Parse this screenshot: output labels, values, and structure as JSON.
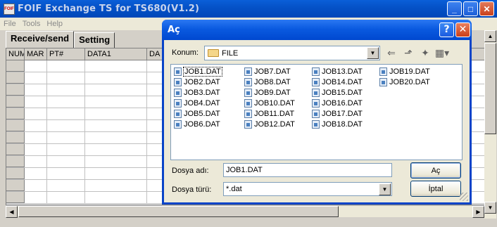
{
  "main_window": {
    "title": "FOIF Exchange TS for TS680(V1.2)",
    "icon_text": "FOIF",
    "minimize": "_",
    "maximize": "□",
    "close": "✕"
  },
  "menu": [
    "File",
    "Tools",
    "Help"
  ],
  "tabs": [
    {
      "label": "Receive/send",
      "active": true
    },
    {
      "label": "Setting",
      "active": false
    }
  ],
  "grid": {
    "columns": [
      "NUM",
      "MAR",
      "PT#",
      "DATA1",
      "DA"
    ],
    "row_count": 12
  },
  "dialog": {
    "title": "Aç",
    "help": "?",
    "close": "✕",
    "look_in_label": "Konum:",
    "look_in_value": "FILE",
    "files": [
      "JOB1.DAT",
      "JOB2.DAT",
      "JOB3.DAT",
      "JOB4.DAT",
      "JOB5.DAT",
      "JOB6.DAT",
      "JOB7.DAT",
      "JOB8.DAT",
      "JOB9.DAT",
      "JOB10.DAT",
      "JOB11.DAT",
      "JOB12.DAT",
      "JOB13.DAT",
      "JOB14.DAT",
      "JOB15.DAT",
      "JOB16.DAT",
      "JOB17.DAT",
      "JOB18.DAT",
      "JOB19.DAT",
      "JOB20.DAT"
    ],
    "selected_file": "JOB1.DAT",
    "file_name_label": "Dosya adı:",
    "file_name_value": "JOB1.DAT",
    "file_type_label": "Dosya türü:",
    "file_type_value": "*.dat",
    "open_button": "Aç",
    "cancel_button": "İptal"
  }
}
